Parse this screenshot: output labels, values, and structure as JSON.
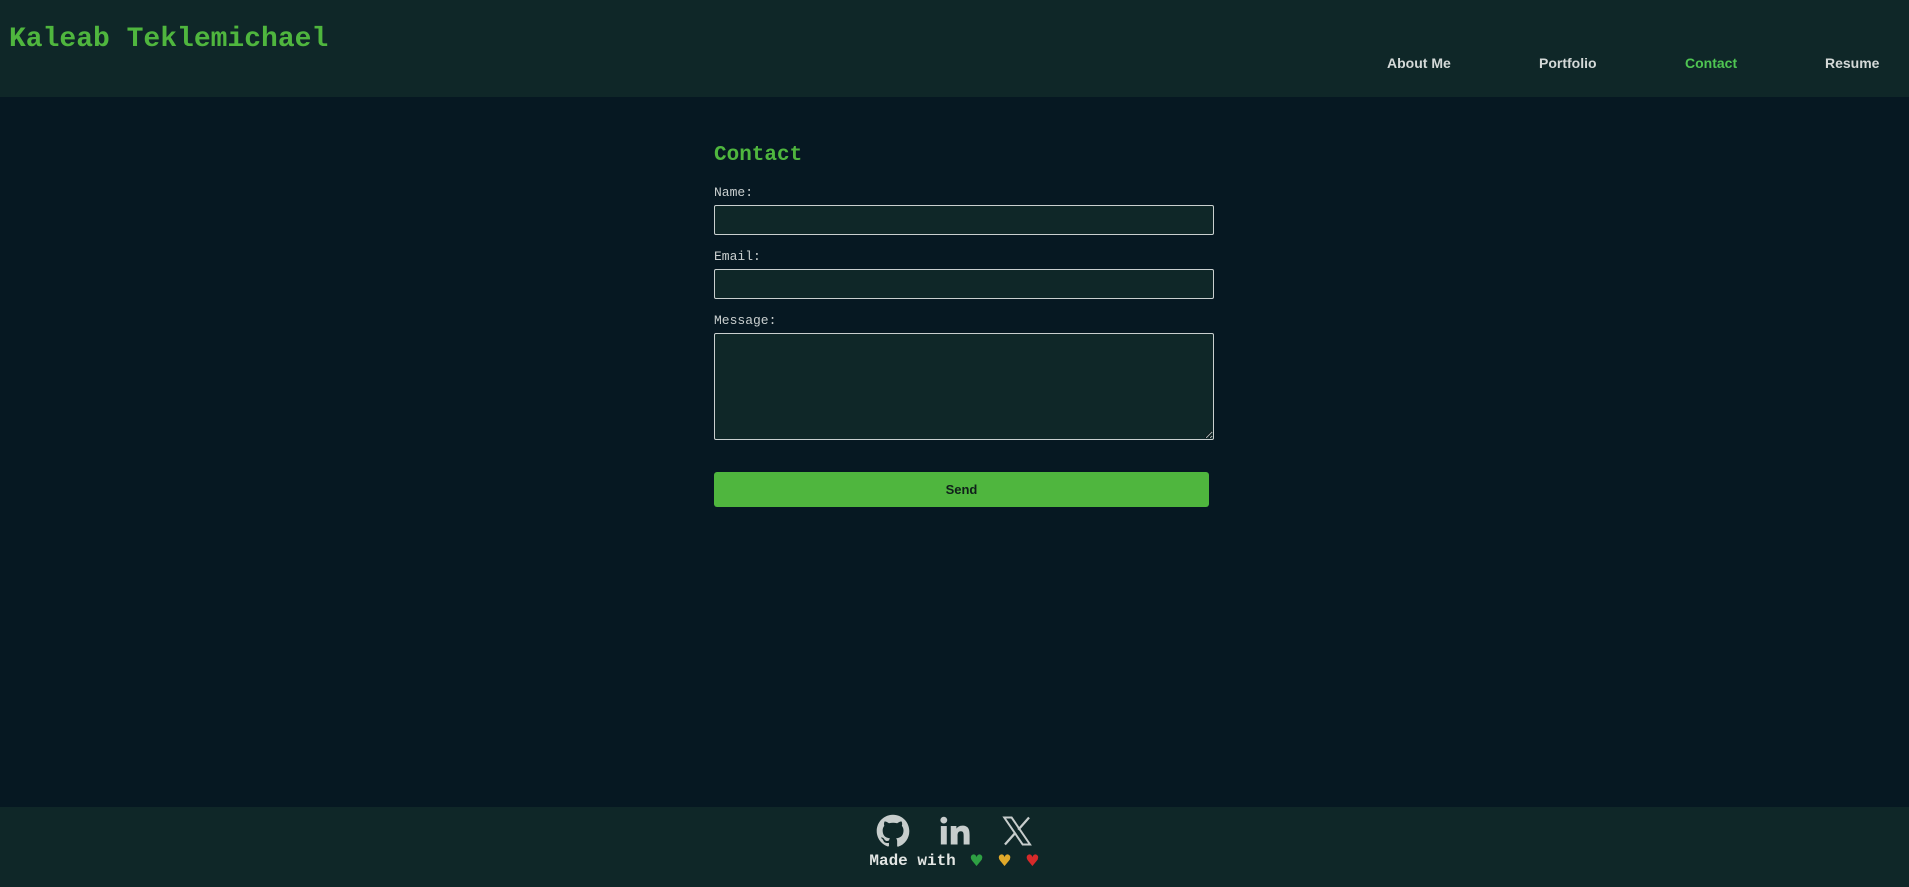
{
  "header": {
    "site_title": "Kaleab Teklemichael",
    "nav": [
      {
        "label": "About Me",
        "active": false
      },
      {
        "label": "Portfolio",
        "active": false
      },
      {
        "label": "Contact",
        "active": true
      },
      {
        "label": "Resume",
        "active": false
      }
    ]
  },
  "contact": {
    "title": "Contact",
    "name_label": "Name:",
    "name_value": "",
    "email_label": "Email:",
    "email_value": "",
    "message_label": "Message:",
    "message_value": "",
    "send_label": "Send"
  },
  "footer": {
    "social_icons": [
      "github-icon",
      "linkedin-icon",
      "x-icon"
    ],
    "made_with": "Made with",
    "hearts": [
      {
        "glyph": "♥",
        "color": "#2ea043"
      },
      {
        "glyph": "♥",
        "color": "#e1a92a"
      },
      {
        "glyph": "♥",
        "color": "#d72a2a"
      }
    ]
  },
  "colors": {
    "background": "#061822",
    "panel": "#0f2728",
    "accent": "#4fb63e",
    "nav_active": "#4fc552",
    "text": "#d4d9d8"
  }
}
